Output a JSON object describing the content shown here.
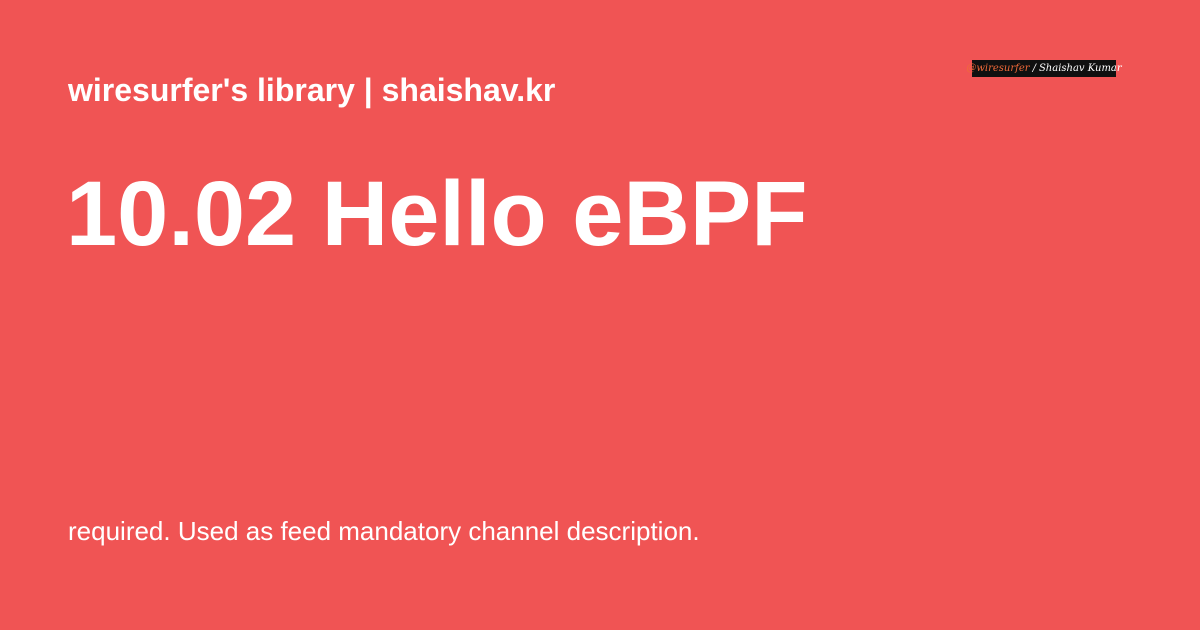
{
  "site": {
    "title": "wiresurfer's library | shaishav.kr"
  },
  "post": {
    "title": "10.02 Hello eBPF",
    "description": "required. Used as feed mandatory channel description."
  },
  "logo": {
    "handle": "@wiresurfer",
    "separator": "/",
    "name": "Shaishav Kumar"
  },
  "colors": {
    "background": "#f05454",
    "text": "#ffffff",
    "logo_background": "#101010",
    "logo_handle": "#f06a3a"
  }
}
